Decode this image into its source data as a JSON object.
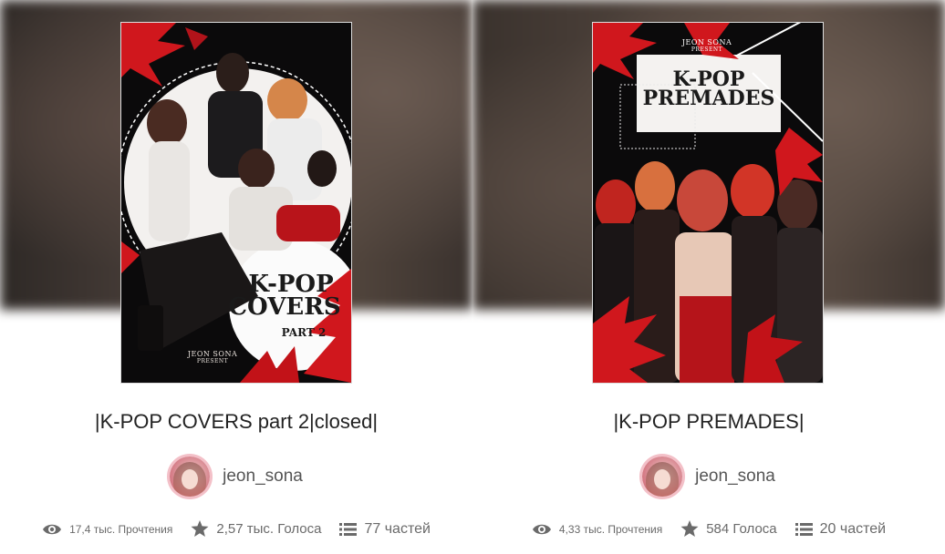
{
  "stories": [
    {
      "title": "|K-POP COVERS part 2|closed|",
      "author": "jeon_sona",
      "cover": {
        "title_line1": "K-POP",
        "title_line2": "COVERS",
        "part": "PART 2",
        "credit_line1": "JEON SONA",
        "credit_line2": "PRESENT"
      },
      "stats": {
        "reads": "17,4 тыс. Прочтения",
        "votes": "2,57 тыс. Голоса",
        "parts": "77 частей"
      }
    },
    {
      "title": "|K-POP PREMADES|",
      "author": "jeon_sona",
      "cover": {
        "title_line1": "K-POP",
        "title_line2": "PREMADES",
        "credit_line1": "JEON SONA",
        "credit_line2": "PRESENT"
      },
      "stats": {
        "reads": "4,33 тыс. Прочтения",
        "votes": "584 Голоса",
        "parts": "20 частей"
      }
    }
  ],
  "colors": {
    "accent_red": "#d0171d",
    "text_dark": "#222222",
    "text_muted": "#6a6a6a"
  },
  "icons": [
    "eye-icon",
    "star-icon",
    "list-icon"
  ]
}
